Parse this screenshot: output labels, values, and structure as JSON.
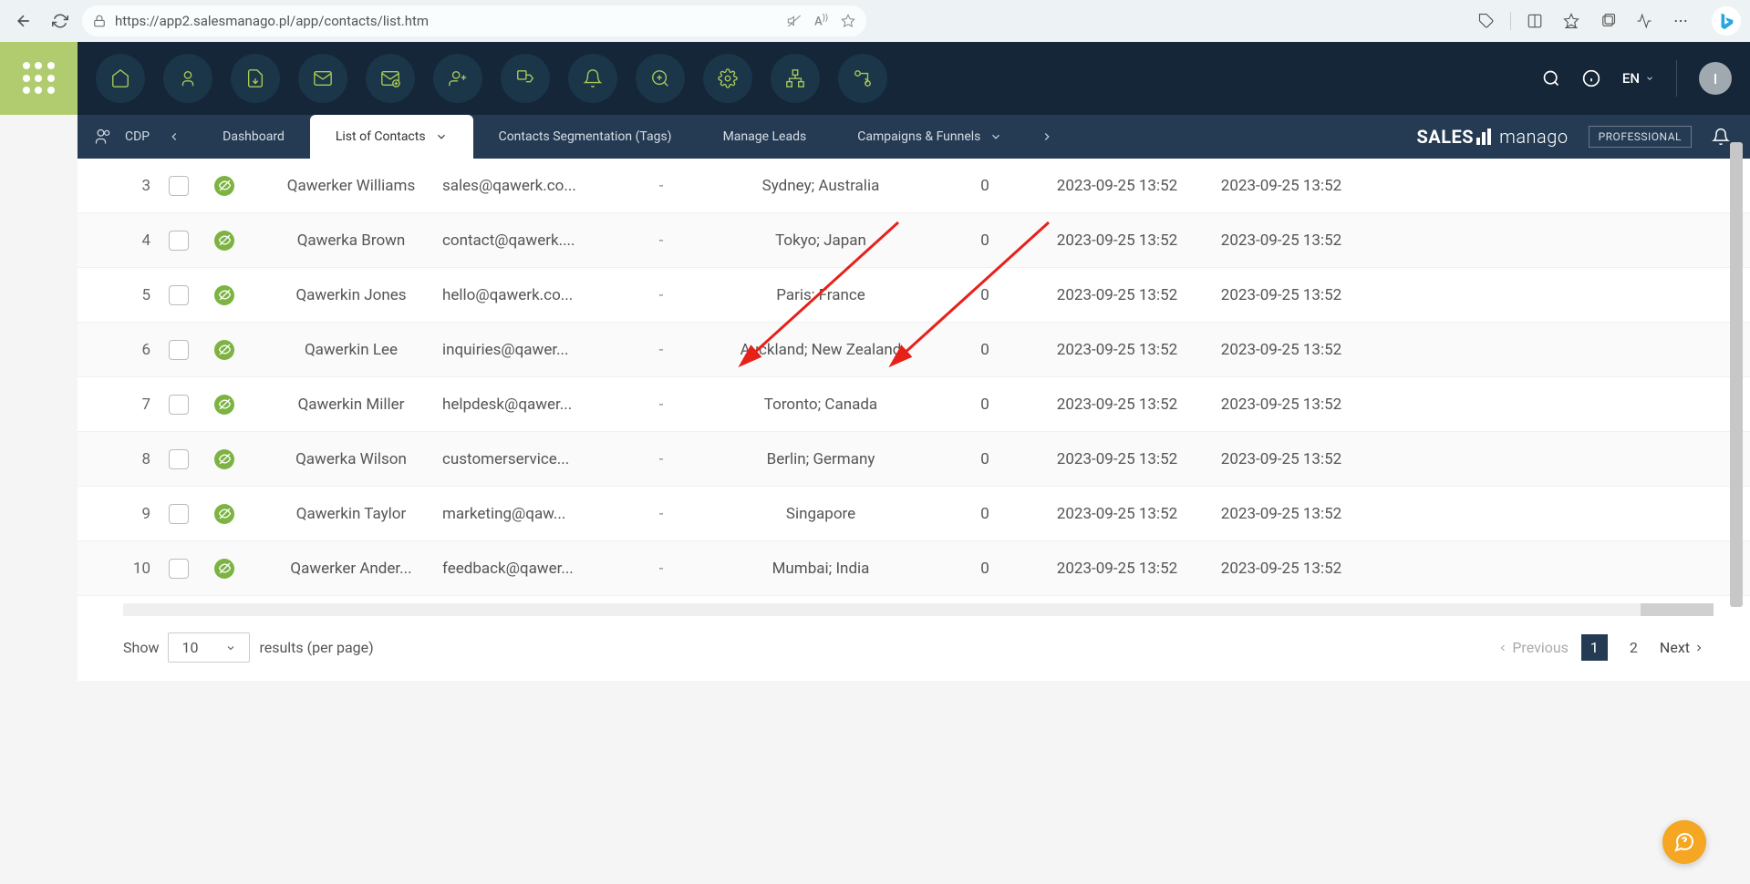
{
  "browser": {
    "url": "https://app2.salesmanago.pl/app/contacts/list.htm"
  },
  "topright": {
    "lang": "EN",
    "avatar_initial": "I"
  },
  "subnav": {
    "section": "CDP",
    "tabs": [
      {
        "label": "Dashboard"
      },
      {
        "label": "List of Contacts"
      },
      {
        "label": "Contacts Segmentation (Tags)"
      },
      {
        "label": "Manage Leads"
      },
      {
        "label": "Campaigns & Funnels"
      }
    ],
    "brand_bold": "SALES",
    "brand_rest": "manago",
    "plan": "PROFESSIONAL"
  },
  "contacts": [
    {
      "n": "3",
      "name": "Qawerker Williams",
      "email": "sales@qawerk.co...",
      "dash": "-",
      "loc": "Sydney; Australia",
      "zero": "0",
      "d1": "2023-09-25 13:52",
      "d2": "2023-09-25 13:52"
    },
    {
      "n": "4",
      "name": "Qawerka Brown",
      "email": "contact@qawerk....",
      "dash": "-",
      "loc": "Tokyo; Japan",
      "zero": "0",
      "d1": "2023-09-25 13:52",
      "d2": "2023-09-25 13:52"
    },
    {
      "n": "5",
      "name": "Qawerkin Jones",
      "email": "hello@qawerk.co...",
      "dash": "-",
      "loc": "Paris; France",
      "zero": "0",
      "d1": "2023-09-25 13:52",
      "d2": "2023-09-25 13:52"
    },
    {
      "n": "6",
      "name": "Qawerkin Lee",
      "email": "inquiries@qawer...",
      "dash": "-",
      "loc": "Auckland; New Zealand",
      "zero": "0",
      "d1": "2023-09-25 13:52",
      "d2": "2023-09-25 13:52"
    },
    {
      "n": "7",
      "name": "Qawerkin Miller",
      "email": "helpdesk@qawer...",
      "dash": "-",
      "loc": "Toronto; Canada",
      "zero": "0",
      "d1": "2023-09-25 13:52",
      "d2": "2023-09-25 13:52"
    },
    {
      "n": "8",
      "name": "Qawerka Wilson",
      "email": "customerservice...",
      "dash": "-",
      "loc": "Berlin; Germany",
      "zero": "0",
      "d1": "2023-09-25 13:52",
      "d2": "2023-09-25 13:52"
    },
    {
      "n": "9",
      "name": "Qawerkin Taylor",
      "email": "marketing@qaw...",
      "dash": "-",
      "loc": "Singapore",
      "zero": "0",
      "d1": "2023-09-25 13:52",
      "d2": "2023-09-25 13:52"
    },
    {
      "n": "10",
      "name": "Qawerker Ander...",
      "email": "feedback@qawer...",
      "dash": "-",
      "loc": "Mumbai; India",
      "zero": "0",
      "d1": "2023-09-25 13:52",
      "d2": "2023-09-25 13:52"
    }
  ],
  "footer": {
    "show": "Show",
    "per_page": "10",
    "results": "results (per page)",
    "prev": "Previous",
    "p1": "1",
    "p2": "2",
    "next": "Next"
  }
}
